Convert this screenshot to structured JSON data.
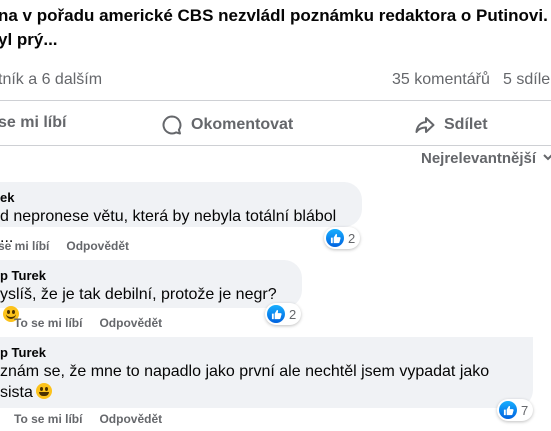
{
  "post": {
    "title_line1": "na v pořadu americké CBS nezvládl poznámku redaktora o Putinovi.",
    "title_line2": "yl prý..."
  },
  "stats": {
    "reactors": "tník a 6 dalším",
    "comments": "35 komentářů",
    "shares": "5 sdíle"
  },
  "actions": {
    "like": "se mi líbí",
    "comment": "Okomentovat",
    "share": "Sdílet"
  },
  "sort": {
    "label": "Nejrelevantnější"
  },
  "comments": [
    {
      "author": "ek",
      "text": "d nepronese větu, která by nebyla totální blábol ...",
      "like_label": "se mi líbí",
      "reply_label": "Odpovědět",
      "reactions": "2"
    },
    {
      "author": "p Turek",
      "text": "yslíš, že je tak debilní, protože je negr?",
      "emoji": "slightly-smiling-face-icon",
      "like_label": "To se mi líbí",
      "reply_label": "Odpovědět",
      "reactions": "2"
    },
    {
      "author": "p Turek",
      "text_line1": "znám se, že mne to napadlo jako první ale nechtěl jsem vypadat jako",
      "text_line2": "sista",
      "emoji": "grinning-face-icon",
      "like_label": "To se mi líbí",
      "reply_label": "Odpovědět",
      "reactions": "7"
    }
  ],
  "colors": {
    "secondary_text": "#65676b",
    "bubble_bg": "#f0f2f5",
    "like_blue": "#0866ff",
    "divider": "#ced0d4"
  }
}
